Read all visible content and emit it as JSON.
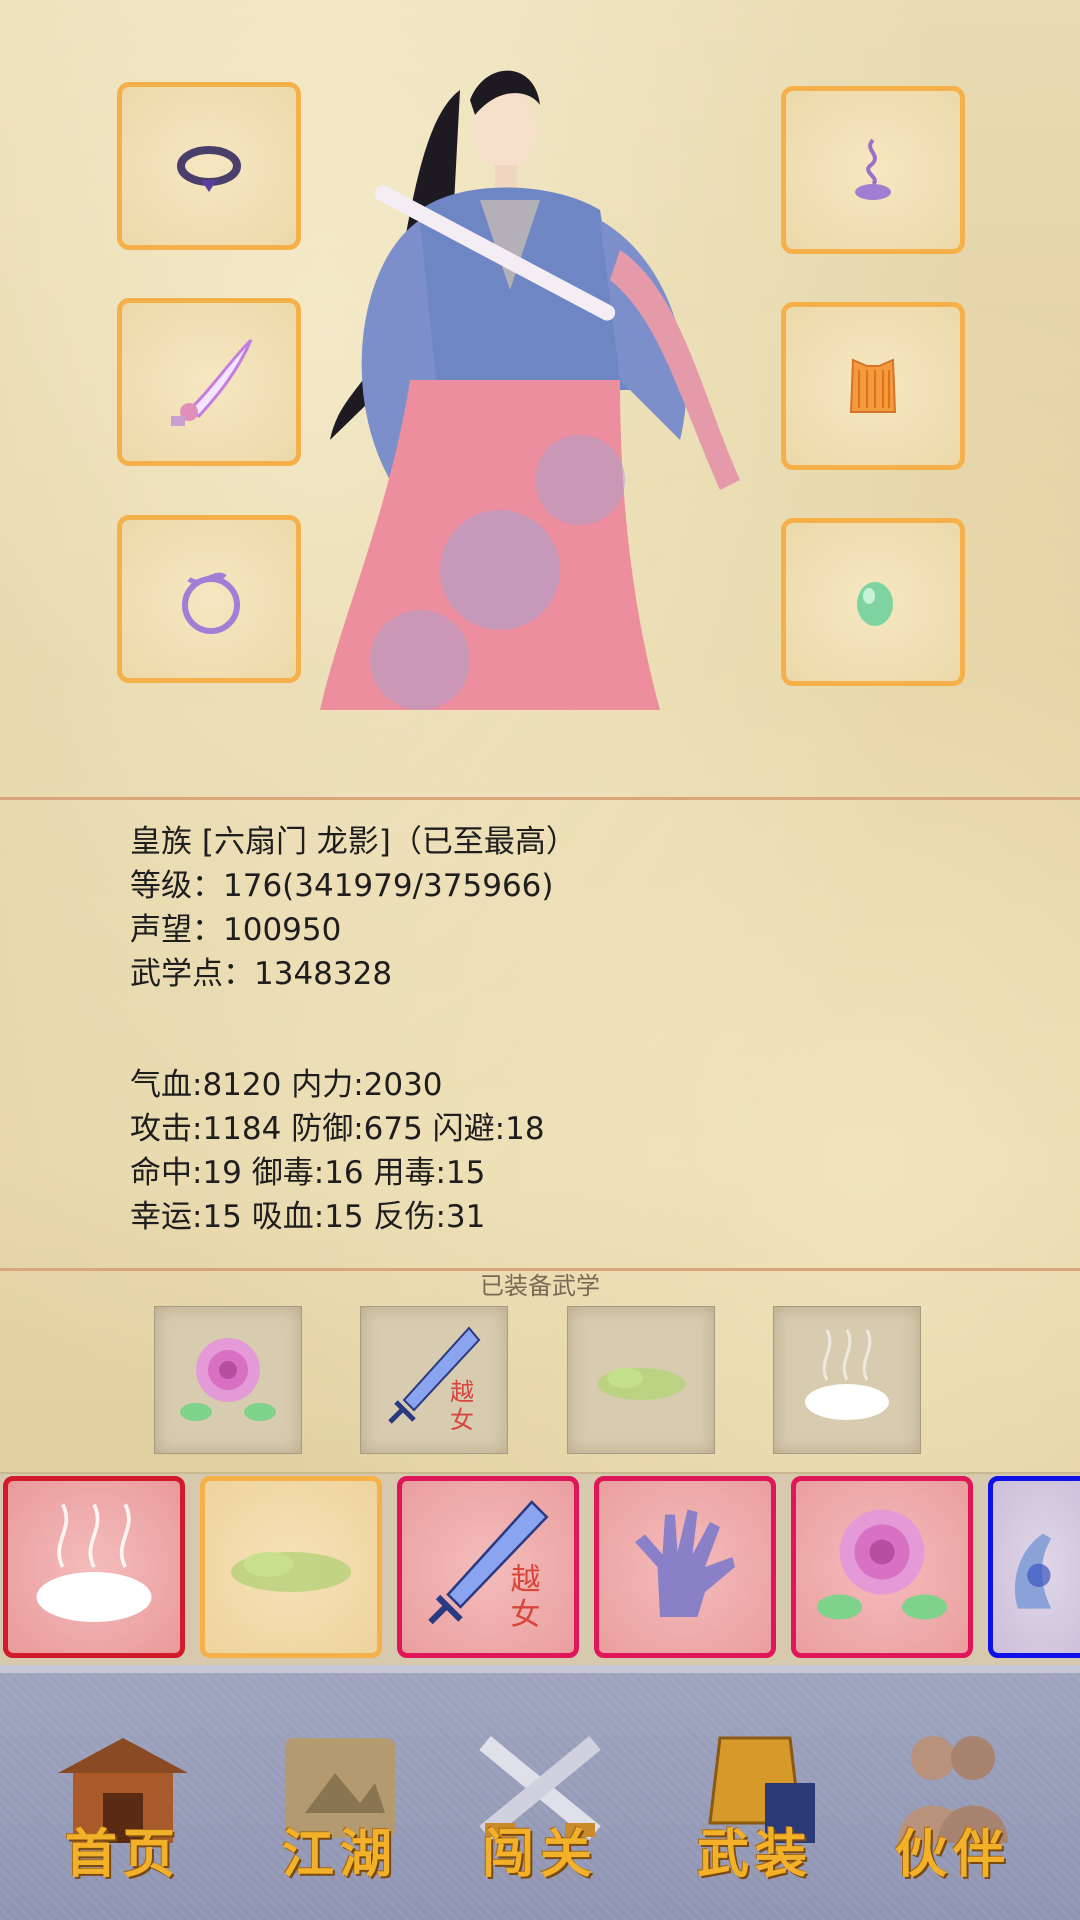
{
  "equipment_slots": [
    {
      "icon": "ring-icon"
    },
    {
      "icon": "incense-icon"
    },
    {
      "icon": "curved-blade-icon"
    },
    {
      "icon": "armor-vest-icon"
    },
    {
      "icon": "bracelet-icon"
    },
    {
      "icon": "jade-stone-icon"
    }
  ],
  "profile": {
    "title": "皇族 [六扇门 龙影]（已至最高）",
    "level": "等级：176(341979/375966)",
    "reputation": "声望：100950",
    "martial_points": "武学点：1348328"
  },
  "stats": {
    "line1": "气血:8120  内力:2030",
    "line2": "攻击:1184  防御:675  闪避:18",
    "line3": "命中:19  御毒:16  用毒:15",
    "line4": "幸运:15  吸血:15  反伤:31"
  },
  "equipped_skills_title": "已装备武学",
  "equipped_skills": [
    {
      "icon": "rose-icon"
    },
    {
      "icon": "yuenv-sword-icon",
      "glyph_top": "越",
      "glyph_bottom": "女"
    },
    {
      "icon": "green-mist-icon"
    },
    {
      "icon": "white-steam-icon"
    }
  ],
  "skill_cards": [
    {
      "icon": "white-steam-icon",
      "border": "#d11a2a"
    },
    {
      "icon": "green-mist-icon",
      "border": "#f5b04a"
    },
    {
      "icon": "yuenv-sword-icon",
      "border": "#e0165a",
      "glyph_top": "越",
      "glyph_bottom": "女"
    },
    {
      "icon": "palm-icon",
      "border": "#e0165a"
    },
    {
      "icon": "rose-icon",
      "border": "#e0165a"
    },
    {
      "icon": "blue-palm-icon",
      "border": "#1010e8"
    }
  ],
  "nav": [
    {
      "label": "首页",
      "icon": "house-icon"
    },
    {
      "label": "江湖",
      "icon": "scroll-map-icon"
    },
    {
      "label": "闯关",
      "icon": "crossed-swords-icon"
    },
    {
      "label": "武装",
      "icon": "armor-book-icon"
    },
    {
      "label": "伙伴",
      "icon": "companions-icon"
    }
  ],
  "colors": {
    "slot_border": "#f5b04a",
    "nav_label": "#f2b128",
    "nav_bg": "#9ea3be",
    "card_red_border": "#e0165a",
    "card_blue_border": "#1010e8"
  }
}
